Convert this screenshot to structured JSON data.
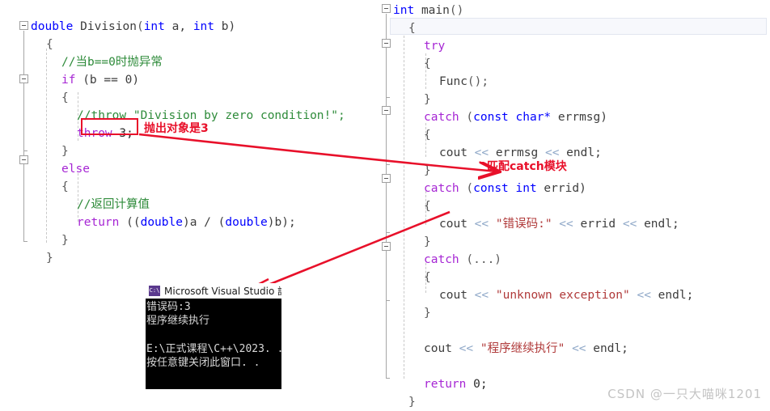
{
  "editor": {
    "left_pane": {
      "lines": [
        {
          "indent": 0,
          "tokens": [
            {
              "t": "double",
              "c": "kw"
            },
            {
              "t": " ",
              "c": "pun"
            },
            {
              "t": "Division",
              "c": "id"
            },
            {
              "t": "(",
              "c": "pun"
            },
            {
              "t": "int",
              "c": "kw"
            },
            {
              "t": " a, ",
              "c": "id"
            },
            {
              "t": "int",
              "c": "kw"
            },
            {
              "t": " b)",
              "c": "id"
            }
          ]
        },
        {
          "indent": 1,
          "tokens": [
            {
              "t": "{",
              "c": "pun"
            }
          ]
        },
        {
          "indent": 2,
          "tokens": [
            {
              "t": "//当b==0时抛异常",
              "c": "cmt"
            }
          ]
        },
        {
          "indent": 2,
          "tokens": [
            {
              "t": "if",
              "c": "kwp"
            },
            {
              "t": " (b ",
              "c": "id"
            },
            {
              "t": "==",
              "c": "id"
            },
            {
              "t": " 0)",
              "c": "id"
            }
          ]
        },
        {
          "indent": 2,
          "tokens": [
            {
              "t": "{",
              "c": "pun"
            }
          ]
        },
        {
          "indent": 3,
          "tokens": [
            {
              "t": "//throw \"Division by zero condition!\";",
              "c": "cmt"
            }
          ]
        },
        {
          "indent": 3,
          "tokens": [
            {
              "t": "throw",
              "c": "kwp"
            },
            {
              "t": " 3;",
              "c": "num"
            }
          ]
        },
        {
          "indent": 2,
          "tokens": [
            {
              "t": "}",
              "c": "pun"
            }
          ]
        },
        {
          "indent": 2,
          "tokens": [
            {
              "t": "else",
              "c": "kwp"
            }
          ]
        },
        {
          "indent": 2,
          "tokens": [
            {
              "t": "{",
              "c": "pun"
            }
          ]
        },
        {
          "indent": 3,
          "tokens": [
            {
              "t": "//返回计算值",
              "c": "cmt"
            }
          ]
        },
        {
          "indent": 3,
          "tokens": [
            {
              "t": "return",
              "c": "kwp"
            },
            {
              "t": " ((",
              "c": "id"
            },
            {
              "t": "double",
              "c": "kw"
            },
            {
              "t": ")a / (",
              "c": "id"
            },
            {
              "t": "double",
              "c": "kw"
            },
            {
              "t": ")b);",
              "c": "id"
            }
          ]
        },
        {
          "indent": 2,
          "tokens": [
            {
              "t": "}",
              "c": "pun"
            }
          ]
        },
        {
          "indent": 1,
          "tokens": [
            {
              "t": "}",
              "c": "pun"
            }
          ]
        }
      ]
    },
    "right_pane": {
      "lines": [
        {
          "indent": 0,
          "tokens": [
            {
              "t": "int",
              "c": "kw"
            },
            {
              "t": " ",
              "c": "pun"
            },
            {
              "t": "main",
              "c": "id"
            },
            {
              "t": "()",
              "c": "pun"
            }
          ]
        },
        {
          "indent": 1,
          "tokens": [
            {
              "t": "{",
              "c": "pun"
            }
          ]
        },
        {
          "indent": 2,
          "tokens": [
            {
              "t": "try",
              "c": "kwp"
            }
          ]
        },
        {
          "indent": 2,
          "tokens": [
            {
              "t": "{",
              "c": "pun"
            }
          ]
        },
        {
          "indent": 3,
          "tokens": [
            {
              "t": "Func",
              "c": "id"
            },
            {
              "t": "();",
              "c": "pun"
            }
          ]
        },
        {
          "indent": 2,
          "tokens": [
            {
              "t": "}",
              "c": "pun"
            }
          ]
        },
        {
          "indent": 2,
          "tokens": [
            {
              "t": "catch",
              "c": "kwp"
            },
            {
              "t": " (",
              "c": "pun"
            },
            {
              "t": "const char*",
              "c": "kw"
            },
            {
              "t": " errmsg)",
              "c": "id"
            }
          ]
        },
        {
          "indent": 2,
          "tokens": [
            {
              "t": "{",
              "c": "pun"
            }
          ]
        },
        {
          "indent": 3,
          "tokens": [
            {
              "t": "cout ",
              "c": "id"
            },
            {
              "t": "<<",
              "c": "op"
            },
            {
              "t": " errmsg ",
              "c": "id"
            },
            {
              "t": "<<",
              "c": "op"
            },
            {
              "t": " endl;",
              "c": "id"
            }
          ]
        },
        {
          "indent": 2,
          "tokens": [
            {
              "t": "}",
              "c": "pun"
            }
          ]
        },
        {
          "indent": 2,
          "tokens": [
            {
              "t": "catch",
              "c": "kwp"
            },
            {
              "t": " (",
              "c": "pun"
            },
            {
              "t": "const int",
              "c": "kw"
            },
            {
              "t": " errid)",
              "c": "id"
            }
          ]
        },
        {
          "indent": 2,
          "tokens": [
            {
              "t": "{",
              "c": "pun"
            }
          ]
        },
        {
          "indent": 3,
          "tokens": [
            {
              "t": "cout ",
              "c": "id"
            },
            {
              "t": "<<",
              "c": "op"
            },
            {
              "t": " ",
              "c": "id"
            },
            {
              "t": "\"错误码:\"",
              "c": "str"
            },
            {
              "t": " ",
              "c": "id"
            },
            {
              "t": "<<",
              "c": "op"
            },
            {
              "t": " errid ",
              "c": "id"
            },
            {
              "t": "<<",
              "c": "op"
            },
            {
              "t": " endl;",
              "c": "id"
            }
          ]
        },
        {
          "indent": 2,
          "tokens": [
            {
              "t": "}",
              "c": "pun"
            }
          ]
        },
        {
          "indent": 2,
          "tokens": [
            {
              "t": "catch",
              "c": "kwp"
            },
            {
              "t": " (...)",
              "c": "pun"
            }
          ]
        },
        {
          "indent": 2,
          "tokens": [
            {
              "t": "{",
              "c": "pun"
            }
          ]
        },
        {
          "indent": 3,
          "tokens": [
            {
              "t": "cout ",
              "c": "id"
            },
            {
              "t": "<<",
              "c": "op"
            },
            {
              "t": " ",
              "c": "id"
            },
            {
              "t": "\"unknown exception\"",
              "c": "str"
            },
            {
              "t": " ",
              "c": "id"
            },
            {
              "t": "<<",
              "c": "op"
            },
            {
              "t": " endl;",
              "c": "id"
            }
          ]
        },
        {
          "indent": 2,
          "tokens": [
            {
              "t": "}",
              "c": "pun"
            }
          ]
        },
        {
          "indent": 0,
          "tokens": [
            {
              "t": "",
              "c": "pun"
            }
          ]
        },
        {
          "indent": 2,
          "tokens": [
            {
              "t": "cout ",
              "c": "id"
            },
            {
              "t": "<<",
              "c": "op"
            },
            {
              "t": " ",
              "c": "id"
            },
            {
              "t": "\"程序继续执行\"",
              "c": "str"
            },
            {
              "t": " ",
              "c": "id"
            },
            {
              "t": "<<",
              "c": "op"
            },
            {
              "t": " endl;",
              "c": "id"
            }
          ]
        },
        {
          "indent": 0,
          "tokens": [
            {
              "t": "",
              "c": "pun"
            }
          ]
        },
        {
          "indent": 2,
          "tokens": [
            {
              "t": "return",
              "c": "kwp"
            },
            {
              "t": " 0;",
              "c": "num"
            }
          ]
        },
        {
          "indent": 1,
          "tokens": [
            {
              "t": "}",
              "c": "pun"
            }
          ]
        }
      ]
    }
  },
  "annotations": {
    "throw_note": "抛出对象是3",
    "catch_note": "匹配catch模块",
    "accent_color": "#e8102a"
  },
  "console": {
    "icon_label": "C:\\",
    "title": "Microsoft Visual Studio 訓",
    "lines": [
      "错误码:3",
      "程序继续执行",
      "",
      "E:\\正式课程\\C++\\2023. .",
      "按任意键关闭此窗口. ."
    ]
  },
  "watermark": {
    "text": "CSDN @一只大喵咪1201"
  }
}
